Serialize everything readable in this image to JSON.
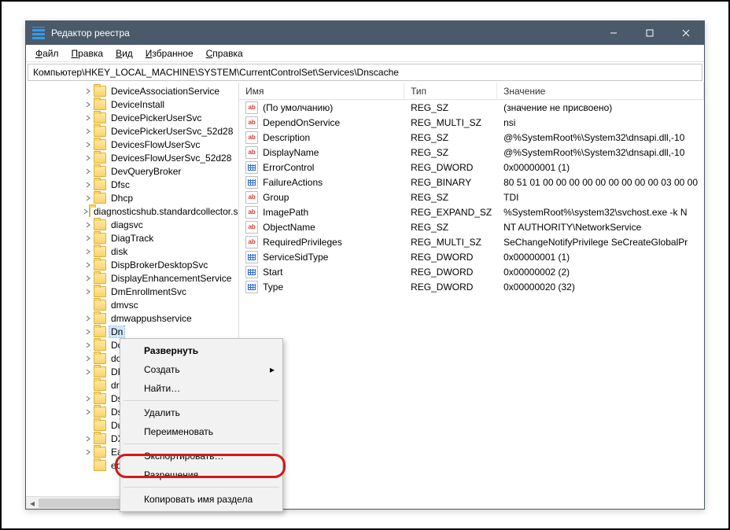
{
  "window": {
    "title": "Редактор реестра"
  },
  "menu": {
    "file": "Файл",
    "edit": "Правка",
    "view": "Вид",
    "favorites": "Избранное",
    "help": "Справка"
  },
  "address": "Компьютер\\HKEY_LOCAL_MACHINE\\SYSTEM\\CurrentControlSet\\Services\\Dnscache",
  "tree": [
    {
      "label": "DeviceAssociationService",
      "expandable": true
    },
    {
      "label": "DeviceInstall",
      "expandable": true
    },
    {
      "label": "DevicePickerUserSvc",
      "expandable": true
    },
    {
      "label": "DevicePickerUserSvc_52d28",
      "expandable": true
    },
    {
      "label": "DevicesFlowUserSvc",
      "expandable": true
    },
    {
      "label": "DevicesFlowUserSvc_52d28",
      "expandable": true
    },
    {
      "label": "DevQueryBroker",
      "expandable": true
    },
    {
      "label": "Dfsc",
      "expandable": true
    },
    {
      "label": "Dhcp",
      "expandable": true
    },
    {
      "label": "diagnosticshub.standardcollector.s",
      "expandable": true
    },
    {
      "label": "diagsvc",
      "expandable": true
    },
    {
      "label": "DiagTrack",
      "expandable": true
    },
    {
      "label": "disk",
      "expandable": true
    },
    {
      "label": "DispBrokerDesktopSvc",
      "expandable": true
    },
    {
      "label": "DisplayEnhancementService",
      "expandable": true
    },
    {
      "label": "DmEnrollmentSvc",
      "expandable": true
    },
    {
      "label": "dmvsc",
      "expandable": false
    },
    {
      "label": "dmwappushservice",
      "expandable": true
    },
    {
      "label": "Dnscache",
      "expandable": true,
      "selected": true,
      "truncated": "Dn"
    },
    {
      "label": "Do",
      "expandable": true,
      "truncated": "Do"
    },
    {
      "label": "do",
      "expandable": true,
      "truncated": "do"
    },
    {
      "label": "DP",
      "expandable": true,
      "truncated": "DP"
    },
    {
      "label": "dr",
      "expandable": false,
      "truncated": "dr"
    },
    {
      "label": "Ds",
      "expandable": true,
      "truncated": "Ds"
    },
    {
      "label": "Ds",
      "expandable": true,
      "truncated": "Ds"
    },
    {
      "label": "Du",
      "expandable": false,
      "truncated": "Du"
    },
    {
      "label": "DX",
      "expandable": true,
      "truncated": "DX"
    },
    {
      "label": "Ea",
      "expandable": true,
      "truncated": "Ea"
    },
    {
      "label": "eb",
      "expandable": false,
      "truncated": "eb"
    }
  ],
  "columns": {
    "name": "Имя",
    "type": "Тип",
    "data": "Значение"
  },
  "values": [
    {
      "icon": "str",
      "name": "(По умолчанию)",
      "type": "REG_SZ",
      "data": "(значение не присвоено)"
    },
    {
      "icon": "str",
      "name": "DependOnService",
      "type": "REG_MULTI_SZ",
      "data": "nsi"
    },
    {
      "icon": "str",
      "name": "Description",
      "type": "REG_SZ",
      "data": "@%SystemRoot%\\System32\\dnsapi.dll,-10"
    },
    {
      "icon": "str",
      "name": "DisplayName",
      "type": "REG_SZ",
      "data": "@%SystemRoot%\\System32\\dnsapi.dll,-10"
    },
    {
      "icon": "bin",
      "name": "ErrorControl",
      "type": "REG_DWORD",
      "data": "0x00000001 (1)"
    },
    {
      "icon": "bin",
      "name": "FailureActions",
      "type": "REG_BINARY",
      "data": "80 51 01 00 00 00 00 00 00 00 00 00 03 00 00"
    },
    {
      "icon": "str",
      "name": "Group",
      "type": "REG_SZ",
      "data": "TDI"
    },
    {
      "icon": "str",
      "name": "ImagePath",
      "type": "REG_EXPAND_SZ",
      "data": "%SystemRoot%\\system32\\svchost.exe -k N"
    },
    {
      "icon": "str",
      "name": "ObjectName",
      "type": "REG_SZ",
      "data": "NT AUTHORITY\\NetworkService"
    },
    {
      "icon": "str",
      "name": "RequiredPrivileges",
      "type": "REG_MULTI_SZ",
      "data": "SeChangeNotifyPrivilege SeCreateGlobalPr"
    },
    {
      "icon": "bin",
      "name": "ServiceSidType",
      "type": "REG_DWORD",
      "data": "0x00000001 (1)"
    },
    {
      "icon": "bin",
      "name": "Start",
      "type": "REG_DWORD",
      "data": "0x00000002 (2)"
    },
    {
      "icon": "bin",
      "name": "Type",
      "type": "REG_DWORD",
      "data": "0x00000020 (32)"
    }
  ],
  "context": {
    "expand": "Развернуть",
    "new": "Создать",
    "find": "Найти…",
    "delete": "Удалить",
    "rename": "Переименовать",
    "export": "Экспортировать…",
    "permissions": "Разрешения…",
    "copykey": "Копировать имя раздела"
  }
}
